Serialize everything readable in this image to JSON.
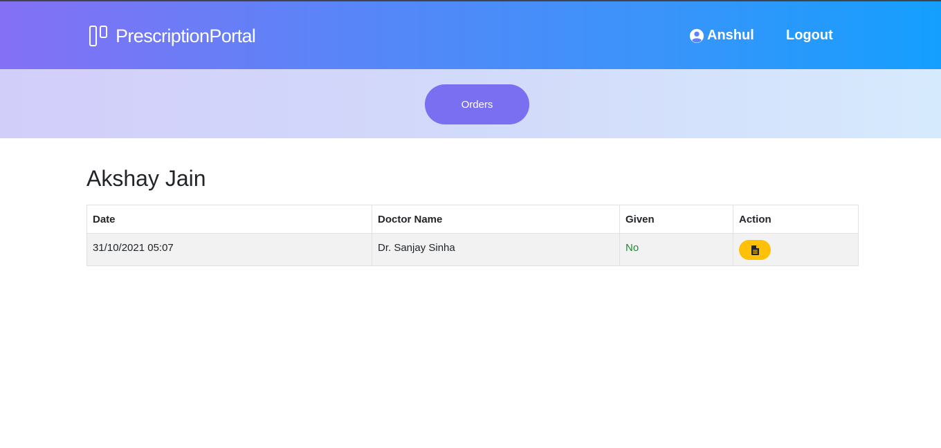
{
  "header": {
    "brand": "PrescriptionPortal",
    "user_name": "Anshul",
    "logout_label": "Logout",
    "gradient_start": "#8470f5",
    "gradient_end": "#149ffe"
  },
  "subnav": {
    "orders_label": "Orders",
    "accent": "#7b6ff1"
  },
  "patient": {
    "name": "Akshay Jain"
  },
  "table": {
    "columns": [
      "Date",
      "Doctor Name",
      "Given",
      "Action"
    ],
    "rows": [
      {
        "date": "31/10/2021 05:07",
        "doctor": "Dr. Sanjay Sinha",
        "given": "No",
        "action_icon": "file-document-icon"
      }
    ],
    "given_color": "#1e8a2e",
    "action_color": "#ffc107"
  }
}
